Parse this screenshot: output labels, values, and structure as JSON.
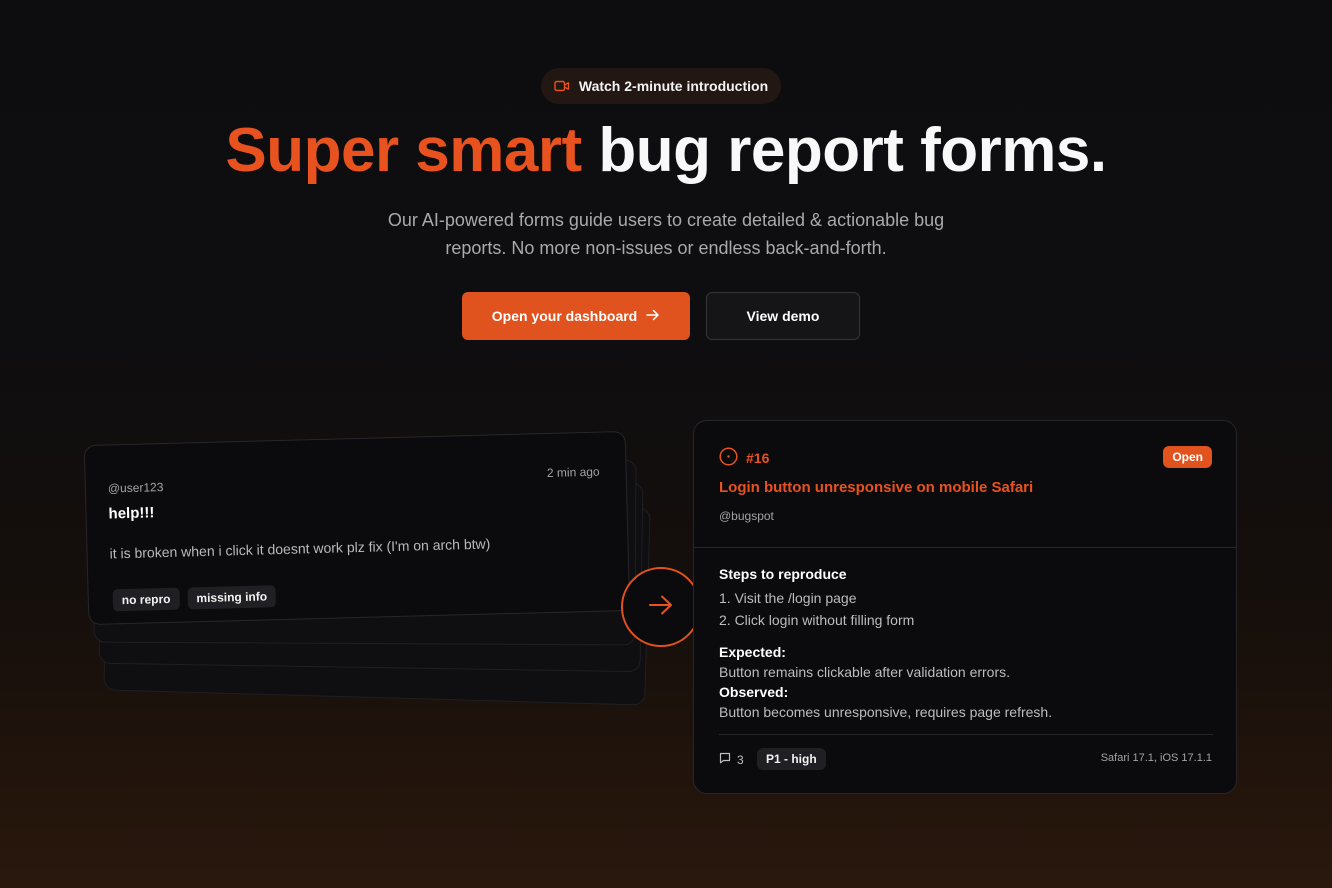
{
  "hero": {
    "intro_pill": {
      "icon": "video-camera-icon",
      "label": "Watch 2-minute introduction"
    },
    "headline_accent": "Super smart",
    "headline_rest": "bug report forms.",
    "subtitle_line1": "Our AI-powered forms guide users to create detailed & actionable bug",
    "subtitle_line2": "reports. No more non-issues or endless back-and-forth.",
    "primary_button": "Open your dashboard",
    "secondary_button": "View demo"
  },
  "colors": {
    "accent": "#e0521e",
    "background": "#0d0d10",
    "card": "#0b0b0d"
  },
  "raw_report": {
    "user": "@user123",
    "time": "2 min ago",
    "title": "help!!!",
    "body": "it is broken when i click it doesnt work plz fix (I'm on arch btw)",
    "tags": [
      "no repro",
      "missing info"
    ]
  },
  "issue": {
    "number": "#16",
    "status": "Open",
    "title": "Login button unresponsive on mobile Safari",
    "author": "@bugspot",
    "steps_heading": "Steps to reproduce",
    "steps": [
      "1. Visit the /login page",
      "2. Click login without filling form"
    ],
    "expected_heading": "Expected:",
    "expected": "Button remains clickable after validation errors.",
    "observed_heading": "Observed:",
    "observed": "Button becomes unresponsive, requires page refresh.",
    "comment_count": "3",
    "priority": "P1 - high",
    "environment": "Safari 17.1, iOS 17.1.1"
  }
}
